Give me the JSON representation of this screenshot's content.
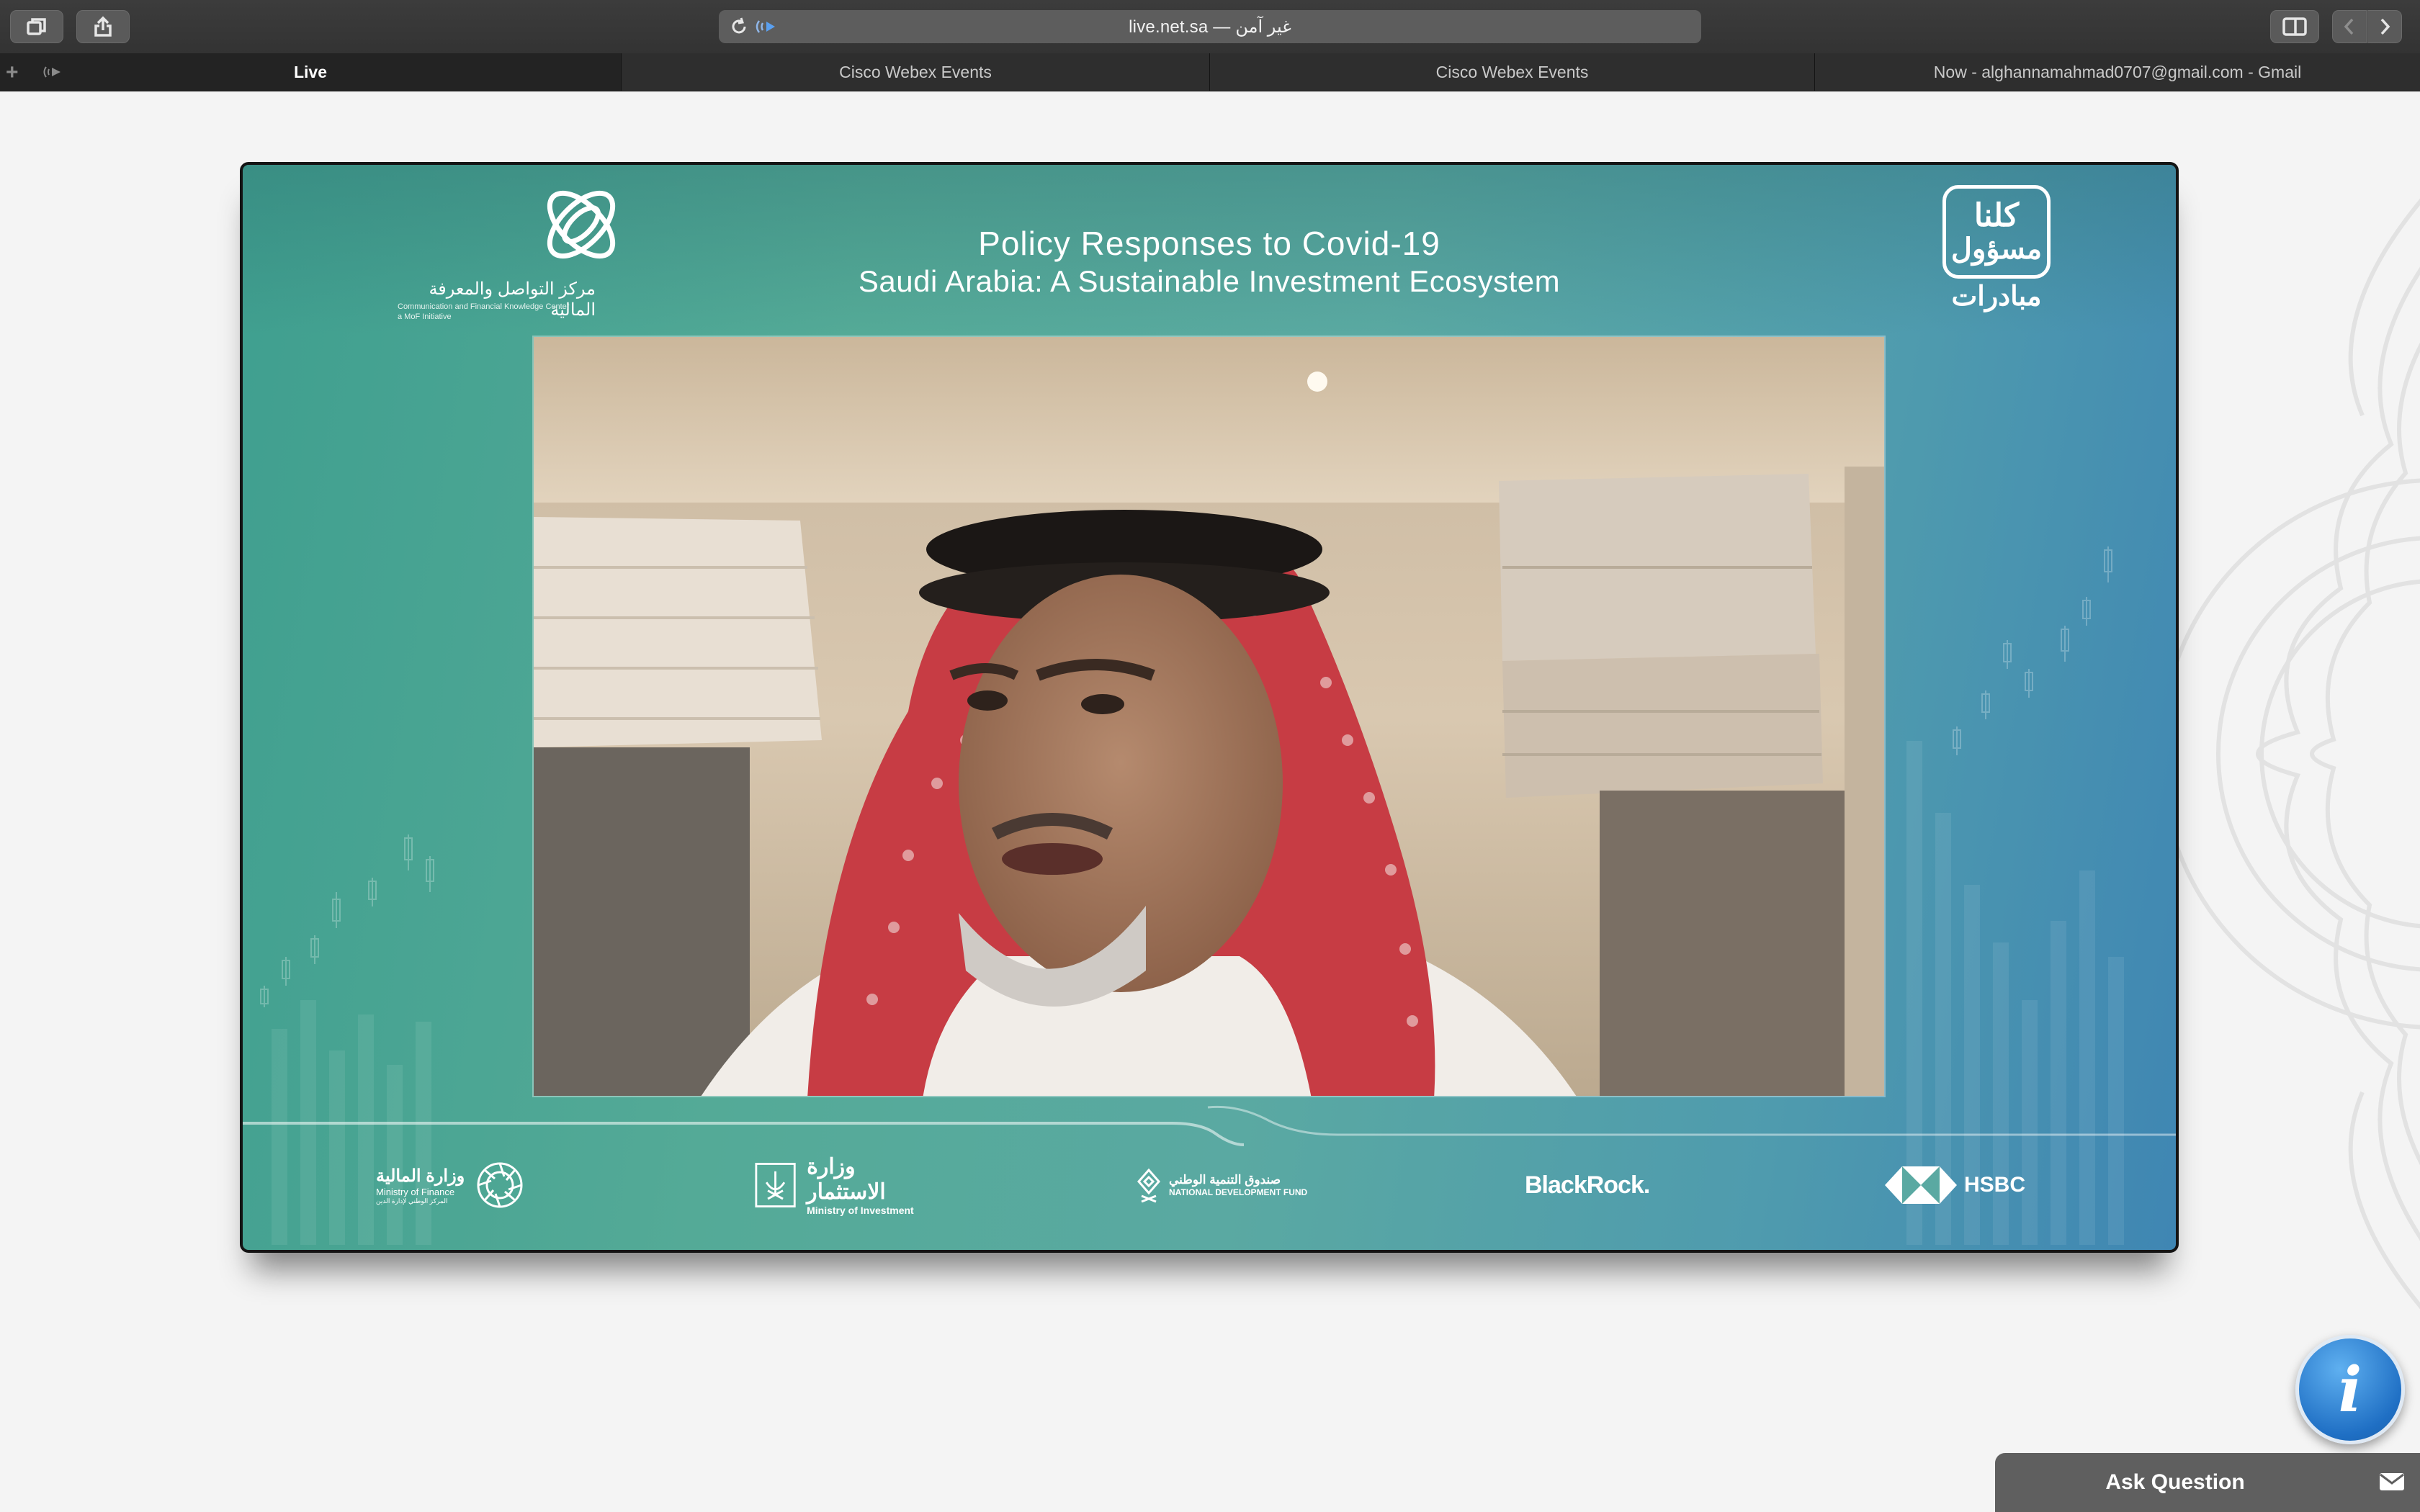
{
  "browser": {
    "url_text": "live.net.sa — غير آمن",
    "tabs": [
      {
        "label": "Live",
        "active": true
      },
      {
        "label": "Cisco Webex Events",
        "active": false
      },
      {
        "label": "Cisco Webex Events",
        "active": false
      },
      {
        "label": "Now - alghannamahmad0707@gmail.com - Gmail",
        "active": false
      }
    ]
  },
  "event": {
    "title_line1": "Policy Responses to Covid-19",
    "title_line2": "Saudi Arabia: A Sustainable Investment Ecosystem",
    "left_logo": {
      "arabic": "مركز التواصل والمعرفة المالية",
      "english_line1": "Communication and Financial Knowledge Center",
      "english_line2": "a MoF Initiative"
    },
    "right_logo": {
      "line1": "كلنا",
      "line2": "مسؤول",
      "line3": "مبادرات"
    },
    "sponsors": {
      "finance_arabic": "وزارة المالية",
      "finance_english": "Ministry of Finance",
      "finance_sub": "المركز الوطني لإدارة الدين",
      "investment_arabic": "وزارة الاستثمار",
      "investment_english": "Ministry of Investment",
      "ndf_arabic": "صندوق التنمية الوطني",
      "ndf_english": "NATIONAL DEVELOPMENT FUND",
      "blackrock": "BlackRock.",
      "hsbc": "HSBC"
    }
  },
  "widgets": {
    "info_glyph": "i",
    "ask_question_label": "Ask Question"
  },
  "colors": {
    "panel_teal": "#54aa97",
    "panel_blue": "#3f86b3",
    "info_blue": "#1f6fc4"
  }
}
